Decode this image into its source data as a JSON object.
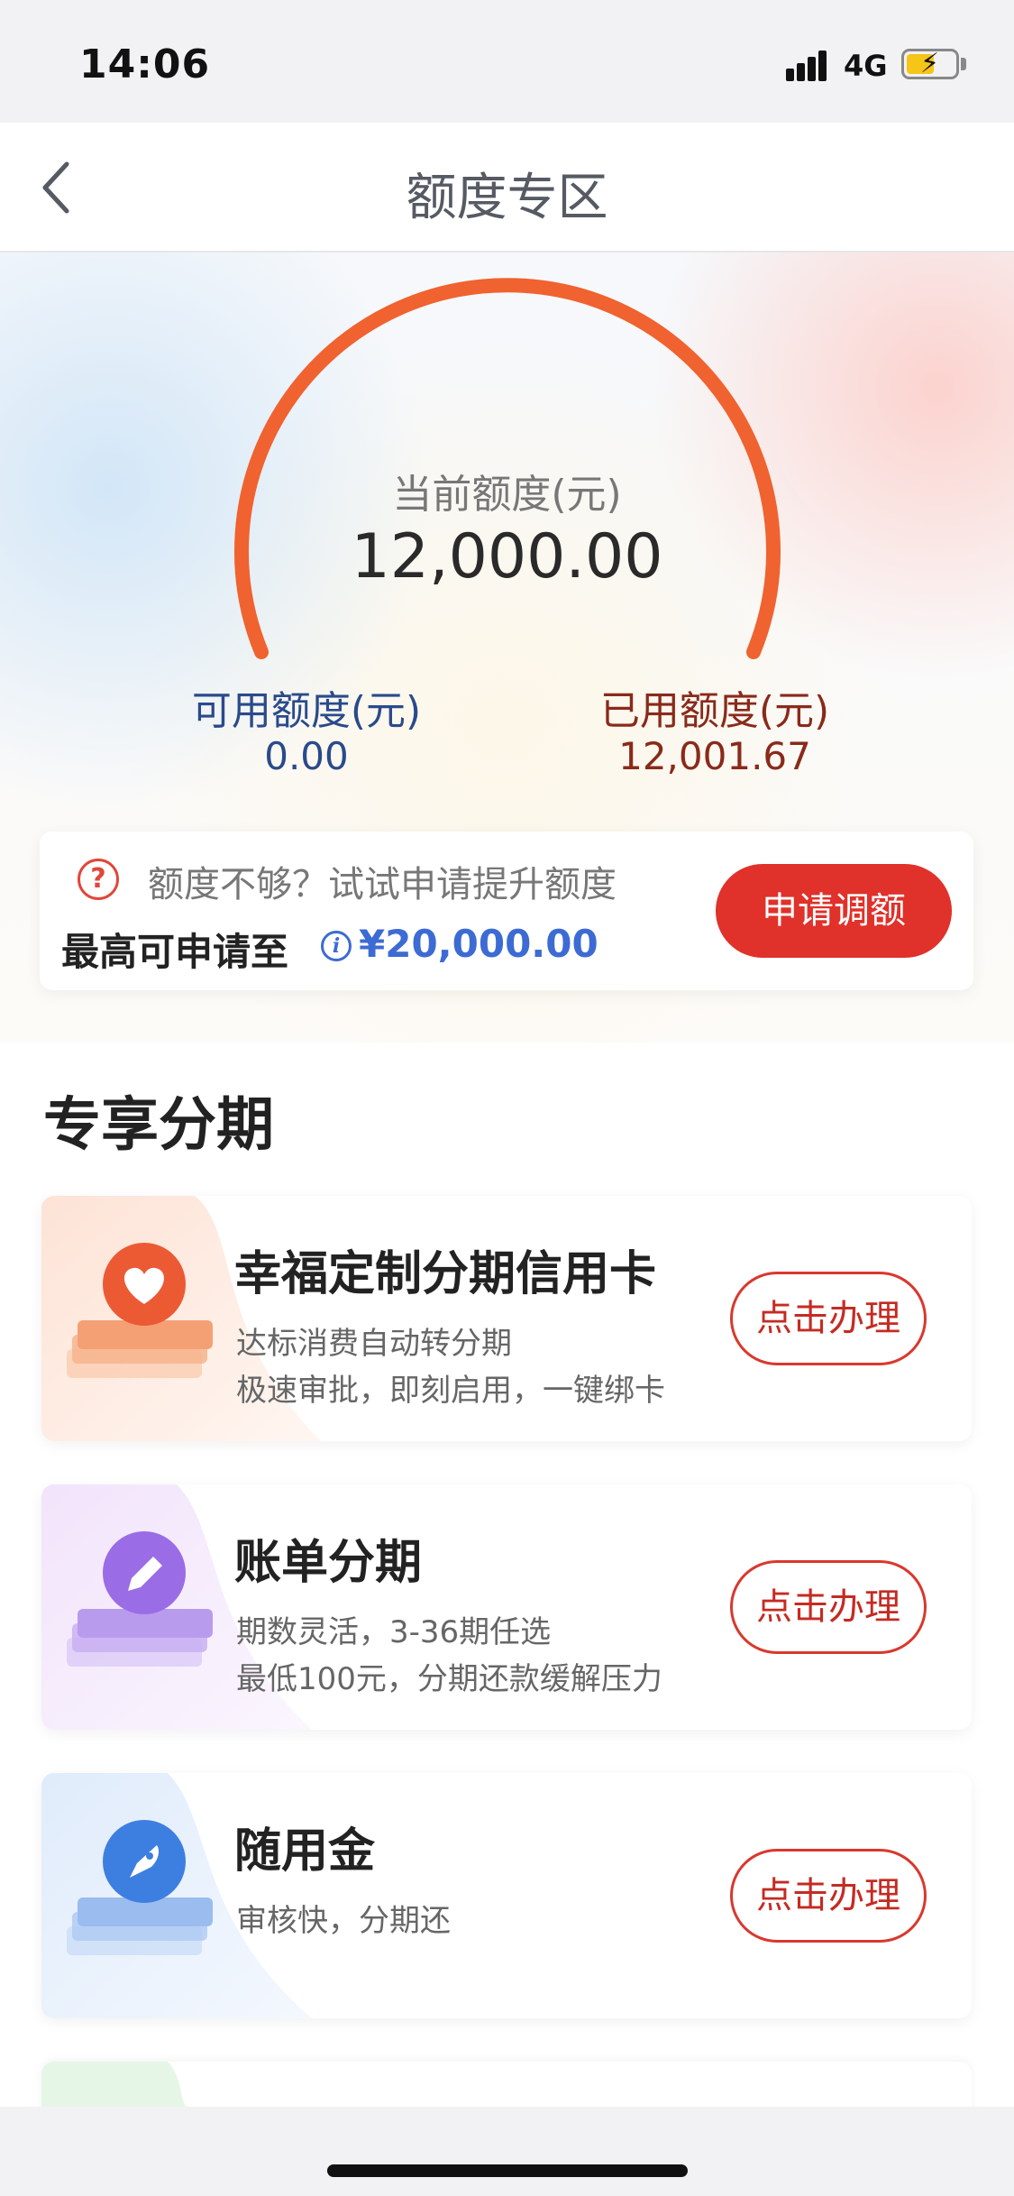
{
  "status_bar": {
    "time": "14:06",
    "network": "4G",
    "icons": [
      "signal-icon",
      "battery-charging-icon"
    ]
  },
  "nav": {
    "title": "额度专区",
    "back_icon": "chevron-left-icon"
  },
  "credit": {
    "current_label": "当前额度(元)",
    "current_value": "12,000.00",
    "available_label": "可用额度(元)",
    "available_value": "0.00",
    "used_label": "已用额度(元)",
    "used_value": "12,001.67"
  },
  "promo": {
    "icon": "question-icon",
    "text": "额度不够？试试申请提升额度",
    "max_label": "最高可申请至",
    "info_icon": "info-icon",
    "max_amount": "¥20,000.00",
    "apply_button": "申请调额"
  },
  "section": {
    "title": "专享分期",
    "cards": [
      {
        "icon": "heart-icon",
        "title": "幸福定制分期信用卡",
        "line1": "达标消费自动转分期",
        "line2": "极速审批，即刻启用，一键绑卡",
        "button": "点击办理"
      },
      {
        "icon": "pencil-icon",
        "title": "账单分期",
        "line1": "期数灵活，3-36期任选",
        "line2": "最低100元，分期还款缓解压力",
        "button": "点击办理"
      },
      {
        "icon": "rocket-icon",
        "title": "随用金",
        "line1": "审核快，分期还",
        "line2": "",
        "button": "点击办理"
      }
    ]
  },
  "colors": {
    "accent": "#e0312a",
    "gauge": "#f0622f",
    "link_blue": "#3d6bd4"
  }
}
